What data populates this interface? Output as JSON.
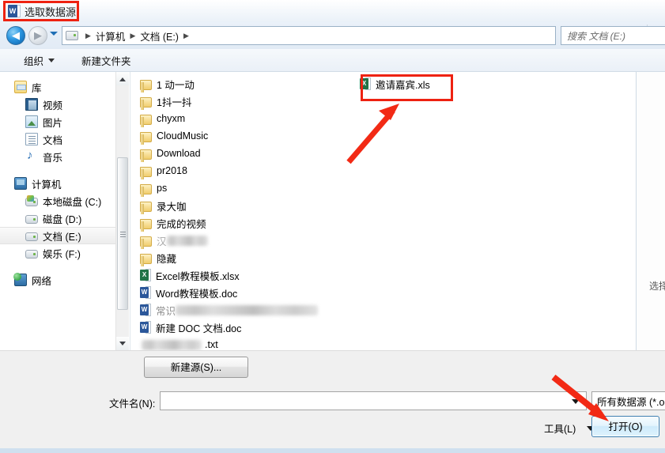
{
  "dialog": {
    "title": "选取数据源",
    "title_icon": "word-document-icon"
  },
  "navbar": {
    "back_icon": "back-arrow-icon",
    "forward_icon": "forward-arrow-icon",
    "history_icon": "history-dropdown-icon",
    "drive_icon": "drive-icon",
    "breadcrumbs": [
      "计算机",
      "文档 (E:)"
    ],
    "separator": "▶",
    "dropdown_icon": "chevron-down-icon",
    "refresh_icon": "refresh-icon",
    "search_placeholder": "搜索 文档 (E:)"
  },
  "toolbar": {
    "organize_label": "组织",
    "new_folder_label": "新建文件夹"
  },
  "navpane": {
    "items": [
      {
        "label": "库",
        "icon": "library-icon",
        "indent": false,
        "selected": false
      },
      {
        "label": "视频",
        "icon": "video-icon",
        "indent": true,
        "selected": false
      },
      {
        "label": "图片",
        "icon": "picture-icon",
        "indent": true,
        "selected": false
      },
      {
        "label": "文档",
        "icon": "document-icon",
        "indent": true,
        "selected": false
      },
      {
        "label": "音乐",
        "icon": "music-icon",
        "indent": true,
        "selected": false
      },
      {
        "label": "计算机",
        "icon": "computer-icon",
        "indent": false,
        "selected": false
      },
      {
        "label": "本地磁盘 (C:)",
        "icon": "harddisk-windows-icon",
        "indent": true,
        "selected": false
      },
      {
        "label": "磁盘 (D:)",
        "icon": "harddisk-icon",
        "indent": true,
        "selected": false
      },
      {
        "label": "文档 (E:)",
        "icon": "harddisk-icon",
        "indent": true,
        "selected": true
      },
      {
        "label": "娱乐 (F:)",
        "icon": "harddisk-icon",
        "indent": true,
        "selected": false
      },
      {
        "label": "网络",
        "icon": "network-icon",
        "indent": false,
        "selected": false
      }
    ]
  },
  "filelist": {
    "column1": [
      {
        "label": "1 动一动",
        "icon": "folder-icon",
        "redacted": false
      },
      {
        "label": "1抖一抖",
        "icon": "folder-icon",
        "redacted": false
      },
      {
        "label": "chyxm",
        "icon": "folder-icon",
        "redacted": false
      },
      {
        "label": "CloudMusic",
        "icon": "folder-icon",
        "redacted": false
      },
      {
        "label": "Download",
        "icon": "folder-icon",
        "redacted": false
      },
      {
        "label": "pr2018",
        "icon": "folder-icon",
        "redacted": false
      },
      {
        "label": "ps",
        "icon": "folder-icon",
        "redacted": false
      },
      {
        "label": "录大咖",
        "icon": "folder-icon",
        "redacted": false
      },
      {
        "label": "完成的视频",
        "icon": "folder-icon",
        "redacted": false
      },
      {
        "label": "汉",
        "icon": "folder-icon",
        "redacted": true,
        "redact_width": 52
      },
      {
        "label": "隐藏",
        "icon": "folder-icon",
        "redacted": false
      },
      {
        "label": "Excel教程模板.xlsx",
        "icon": "excel-file-icon",
        "redacted": false
      },
      {
        "label": "Word教程模板.doc",
        "icon": "word-file-icon",
        "redacted": false
      },
      {
        "label": "常识",
        "icon": "word-file-icon",
        "redacted": true,
        "redact_width": 180
      },
      {
        "label": "新建 DOC 文档.doc",
        "icon": "word-file-icon",
        "redacted": false
      },
      {
        "label": ".txt",
        "icon": "text-file-icon",
        "redacted": true,
        "redact_width": 76
      }
    ],
    "column2": [
      {
        "label": "邀请嘉宾.xls",
        "icon": "excel-file-icon",
        "highlighted": true
      }
    ]
  },
  "preview": {
    "text": "选择"
  },
  "bottom": {
    "new_source_label": "新建源(S)...",
    "filename_label": "文件名(N):",
    "filename_value": "",
    "filetype_value": "所有数据源 (*.od",
    "tools_label": "工具(L)",
    "open_label": "打开(O)"
  },
  "annotations": {
    "color": "#ee2211",
    "title_box": "red-highlight-box-title",
    "file_box": "red-highlight-box-file",
    "arrow_to_file": "red-arrow-pointing-to-file",
    "arrow_to_open": "red-arrow-pointing-to-open-button"
  }
}
